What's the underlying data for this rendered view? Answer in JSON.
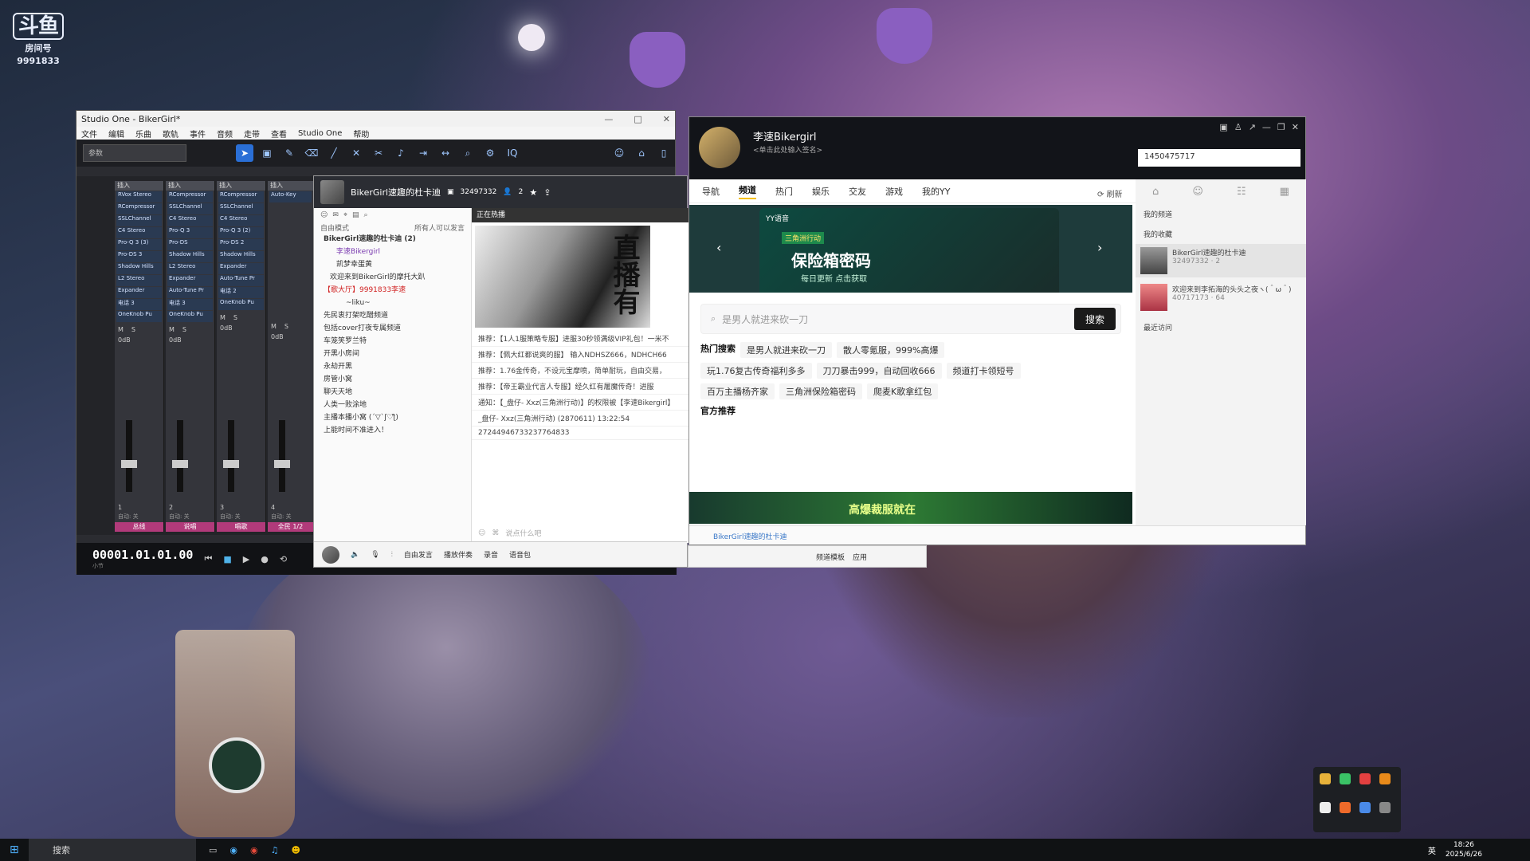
{
  "desktop": {
    "douyu_logo": "斗鱼",
    "douyu_sub": "房间号",
    "douyu_number": "9991833"
  },
  "studio_one": {
    "title": "Studio One - BikerGirl*",
    "menu": [
      "文件",
      "编辑",
      "乐曲",
      "歌轨",
      "事件",
      "音频",
      "走带",
      "查看",
      "Studio One",
      "帮助"
    ],
    "preset": "参数",
    "strips": [
      {
        "label": "插入",
        "inserts": [
          "RVox Stereo",
          "RCompressor",
          "SSLChannel",
          "C4 Stereo",
          "Pro-Q 3 (3)",
          "Pro-DS 3",
          "Shadow Hills",
          "L2 Stereo",
          "Expander",
          "电话 3",
          "OneKnob Pu"
        ],
        "num": "1",
        "bus": "总线"
      },
      {
        "label": "插入",
        "inserts": [
          "RCompressor",
          "SSLChannel",
          "C4 Stereo",
          "Pro-Q 3",
          "Pro-DS",
          "Shadow Hills",
          "L2 Stereo",
          "Expander",
          "Auto-Tune Pr",
          "电话 3",
          "OneKnob Pu"
        ],
        "num": "2",
        "bus": "说唱"
      },
      {
        "label": "插入",
        "inserts": [
          "RCompressor",
          "SSLChannel",
          "C4 Stereo",
          "Pro-Q 3 (2)",
          "Pro-DS 2",
          "Shadow Hills",
          "Expander",
          "Auto-Tune Pr",
          "电话 2",
          "OneKnob Pu"
        ],
        "num": "3",
        "bus": "唱歌"
      },
      {
        "label": "插入",
        "inserts": [
          "Auto-Key"
        ],
        "num": "4",
        "bus": "全民 1/2"
      }
    ],
    "db_label": "0dB",
    "mute": "M",
    "solo": "S",
    "auto": "自动: 关",
    "time": "00001.01.01.00",
    "time_unit": "小节"
  },
  "yy_room": {
    "channel_name": "BikerGirl速趣的杜卡迪",
    "room_id": "32497332",
    "viewers": "2",
    "mode": "自由模式",
    "mode_note": "所有人可以发言",
    "channels": [
      "BikerGirl速趣的杜卡迪 (2)",
      "李速Bikergirl",
      "凯梦幸蛋黄",
      "欢迎来到BikerGirl的摩托大趴",
      "【歌大厅】9991833李速",
      "~liku~",
      "先民衷打架吃醋频道",
      "包括cover打夜专属频道",
      "车笼笑罗兰特",
      "开黑小房间",
      "永劫开黑",
      "房管小窝",
      "聊天天地",
      "人类一败涂地",
      "主播本播小窝 (´▽`ʃ♡ƪ)",
      "上能时间不准进入！"
    ],
    "live_header": "正在热播",
    "live_text": "直播有",
    "messages": [
      "推荐：【1人1服策略专服】进服30秒领满级VIP礼包！一米不",
      "推荐：【佩大红都说爽的服】 输入NDHSZ666，NDHCH66",
      "推荐：1.76金传奇，不设元宝摩喷，简单耐玩，自由交易，",
      "推荐：【帝王霸业代言人专服】经久红有屠魔传奇！进服",
      "通知：【_盘仔- Xxz(三角洲行动)】的权限被【李速Bikergirl】",
      "_盘仔- Xxz(三角洲行动) (2870611) 13:22:54",
      "27244946733237764833"
    ],
    "input_placeholder": "说点什么吧",
    "bottom_items": [
      "自由发言",
      "播放伴奏",
      "录音",
      "语音包"
    ]
  },
  "yy_main": {
    "user_name": "李速Bikergirl",
    "signature": "<单击此处输入签名>",
    "id_value": "1450475717",
    "tabs": [
      "导航",
      "频道",
      "热门",
      "娱乐",
      "交友",
      "游戏",
      "我的YY"
    ],
    "active_tab": "频道",
    "refresh": "刷新",
    "banner_brand": "YY语音",
    "banner_tag": "三角洲行动",
    "banner_title": "保险箱密码",
    "banner_sub": "每日更新 点击获取",
    "search_placeholder": "是男人就进来砍一刀",
    "search_button": "搜索",
    "hot_title": "热门搜索",
    "hot_tags": [
      "是男人就进来砍一刀",
      "散人零氪服，999%高爆",
      "玩1.76复古传奇福利多多",
      "刀刀暴击999，自动回收666",
      "频道打卡领短号",
      "百万主播杨齐家",
      "三角洲保险箱密码",
      "爬麦K歌拿红包"
    ],
    "official": "官方推荐",
    "ad_text": "高爆裁服就在",
    "footer": "BikerGirl速趣的杜卡迪",
    "footer_items": [
      "频道模板",
      "应用"
    ],
    "side": {
      "my_channels": "我的频道",
      "favorites": "我的收藏",
      "rooms": [
        {
          "name": "BikerGirl速趣的杜卡迪",
          "id": "32497332",
          "count": "2"
        },
        {
          "name": "欢迎来到李拓海的头头之夜ヽ(＾ω＾)",
          "id": "40717173",
          "count": "64"
        }
      ],
      "recent": "最近访问"
    }
  },
  "taskbar": {
    "search": "搜索",
    "time": "18:26",
    "date": "2025/6/26",
    "lang": "英"
  }
}
